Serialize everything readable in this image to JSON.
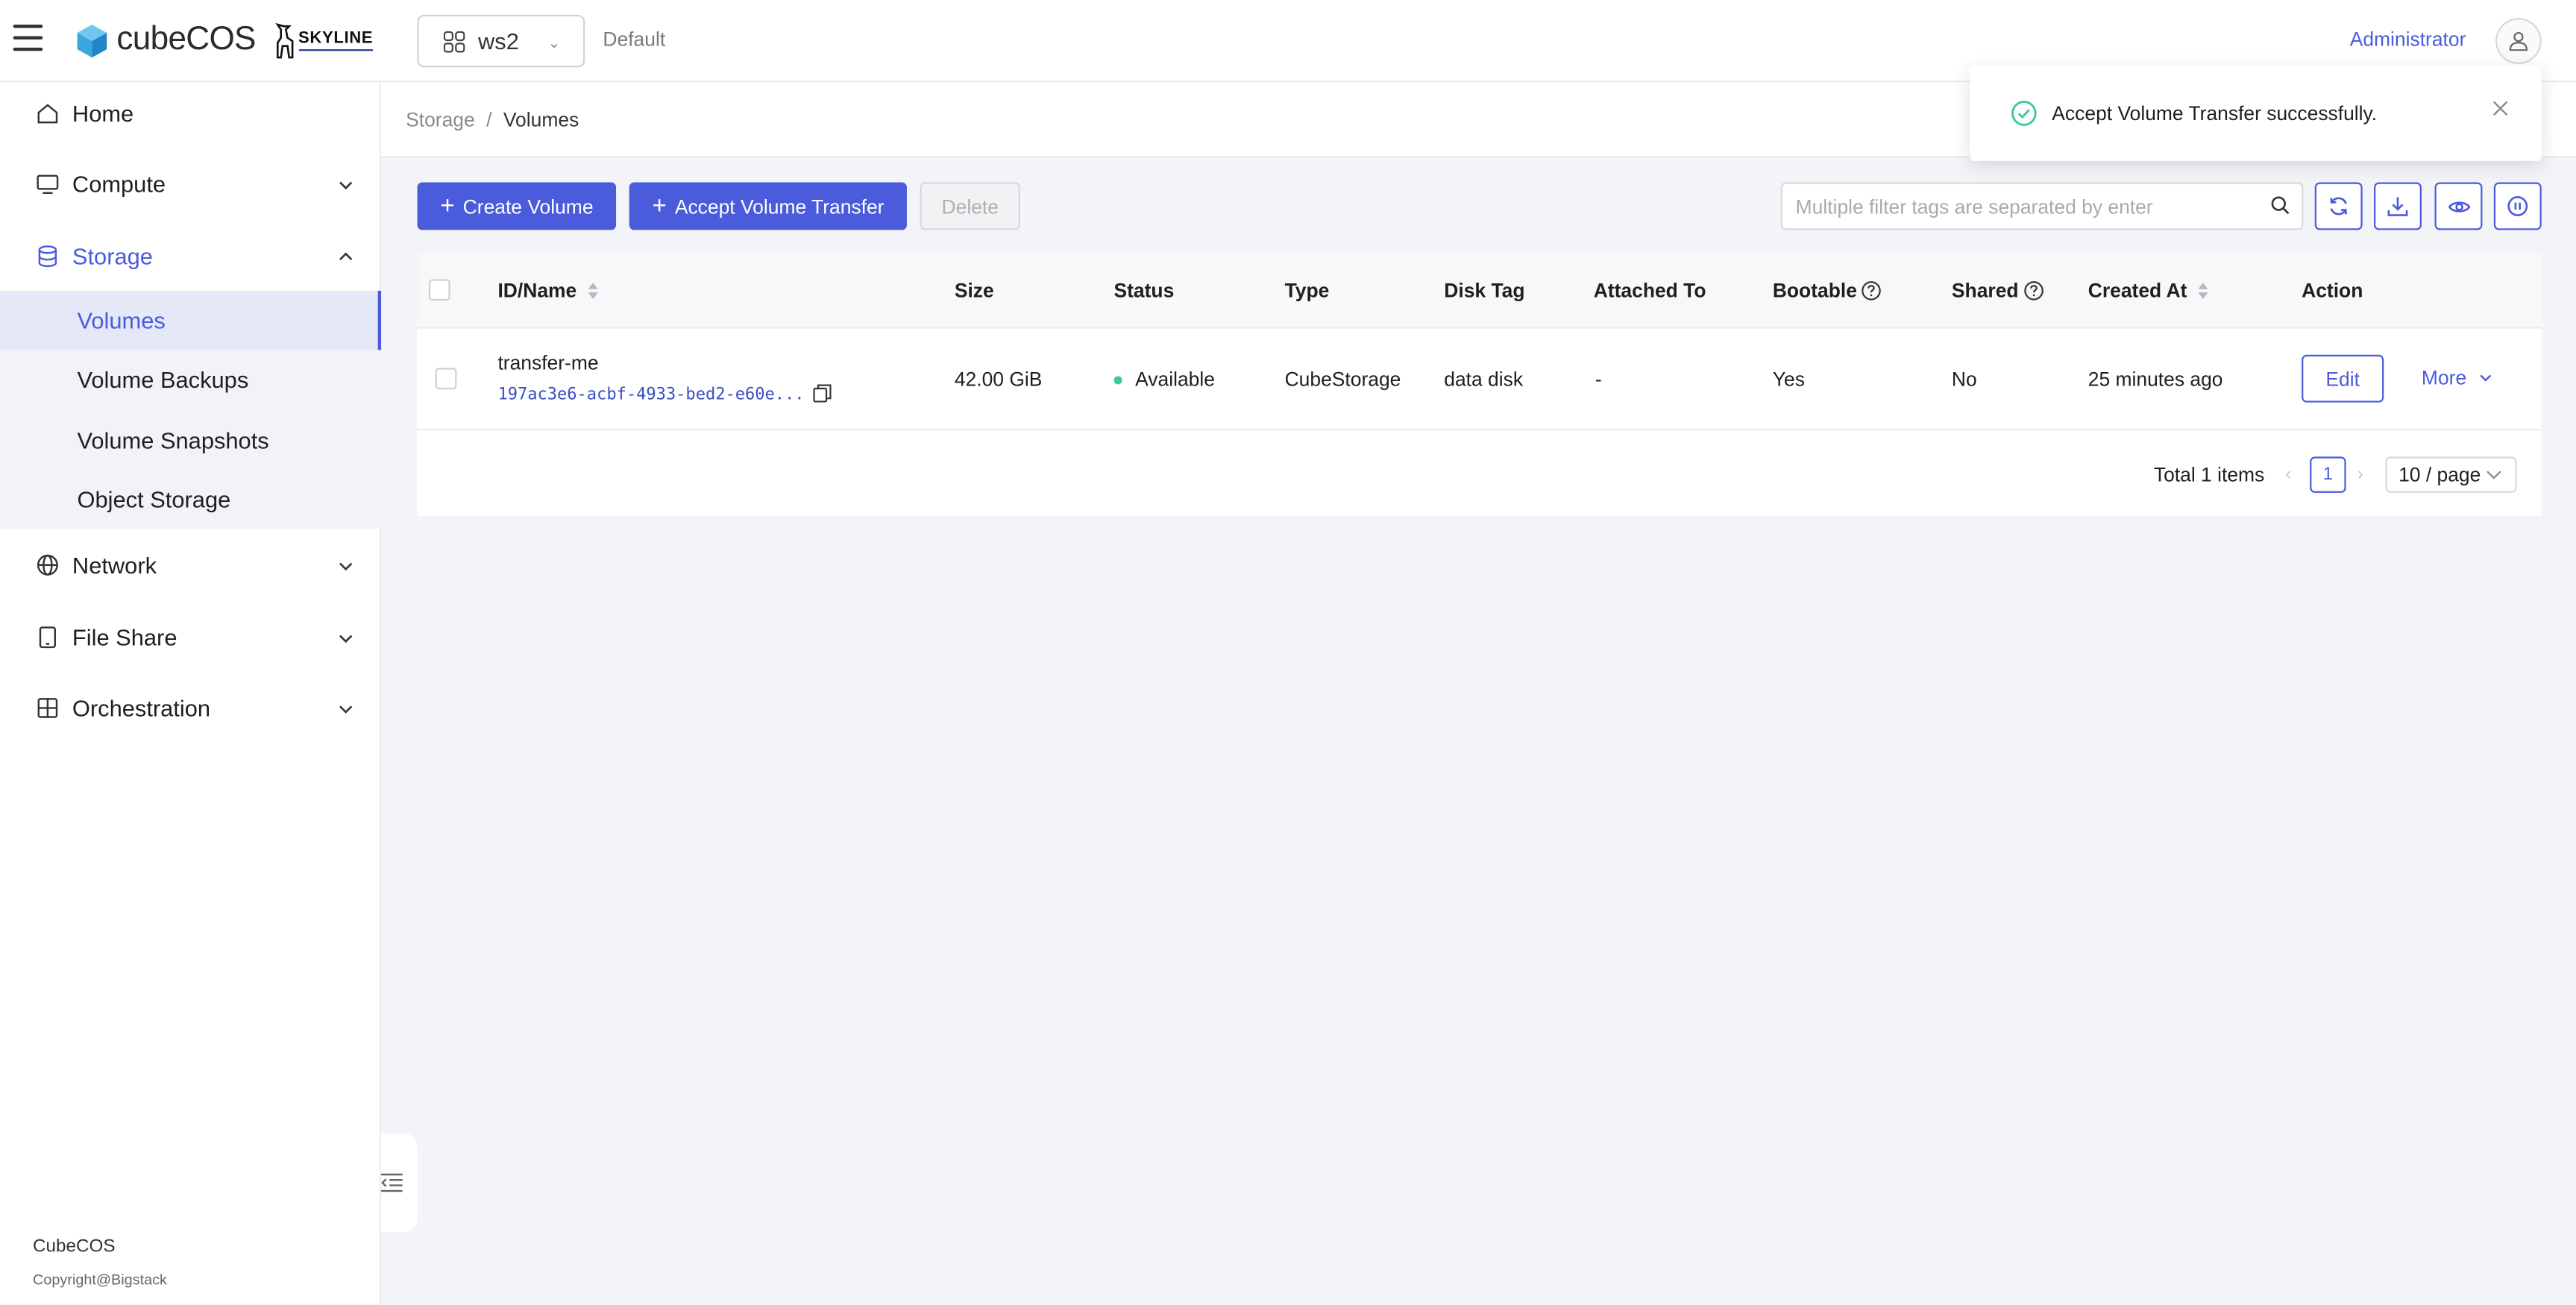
{
  "header": {
    "brand": "cubeCOS",
    "partner_logo": "SKYLINE",
    "workspace": "ws2",
    "domain": "Default",
    "user": "Administrator"
  },
  "sidebar": {
    "items": [
      {
        "label": "Home",
        "icon": "home-icon"
      },
      {
        "label": "Compute",
        "icon": "monitor-icon"
      },
      {
        "label": "Storage",
        "icon": "database-icon",
        "expanded": true
      },
      {
        "label": "Network",
        "icon": "globe-icon"
      },
      {
        "label": "File Share",
        "icon": "tablet-icon"
      },
      {
        "label": "Orchestration",
        "icon": "puzzle-icon"
      }
    ],
    "storage_sub": [
      {
        "label": "Volumes",
        "active": true
      },
      {
        "label": "Volume Backups"
      },
      {
        "label": "Volume Snapshots"
      },
      {
        "label": "Object Storage"
      }
    ],
    "footer_title": "CubeCOS",
    "footer_copyright": "Copyright@Bigstack"
  },
  "breadcrumb": {
    "parent": "Storage",
    "current": "Volumes"
  },
  "toolbar": {
    "create_label": "Create Volume",
    "accept_label": "Accept Volume Transfer",
    "delete_label": "Delete",
    "filter_placeholder": "Multiple filter tags are separated by enter"
  },
  "table": {
    "columns": [
      "ID/Name",
      "Size",
      "Status",
      "Type",
      "Disk Tag",
      "Attached To",
      "Bootable",
      "Shared",
      "Created At",
      "Action"
    ],
    "rows": [
      {
        "name": "transfer-me",
        "id": "197ac3e6-acbf-4933-bed2-e60e...",
        "size": "42.00 GiB",
        "status": "Available",
        "type": "CubeStorage",
        "disk_tag": "data disk",
        "attached_to": "-",
        "bootable": "Yes",
        "shared": "No",
        "created_at": "25 minutes ago",
        "edit_label": "Edit",
        "more_label": "More"
      }
    ]
  },
  "pagination": {
    "total": "Total 1 items",
    "page": "1",
    "page_size": "10 / page"
  },
  "toast": {
    "message": "Accept Volume Transfer successfully."
  },
  "colors": {
    "accent": "#4a5bdc",
    "status_available": "#3fc79a",
    "toast_ok": "#3fc79a"
  }
}
